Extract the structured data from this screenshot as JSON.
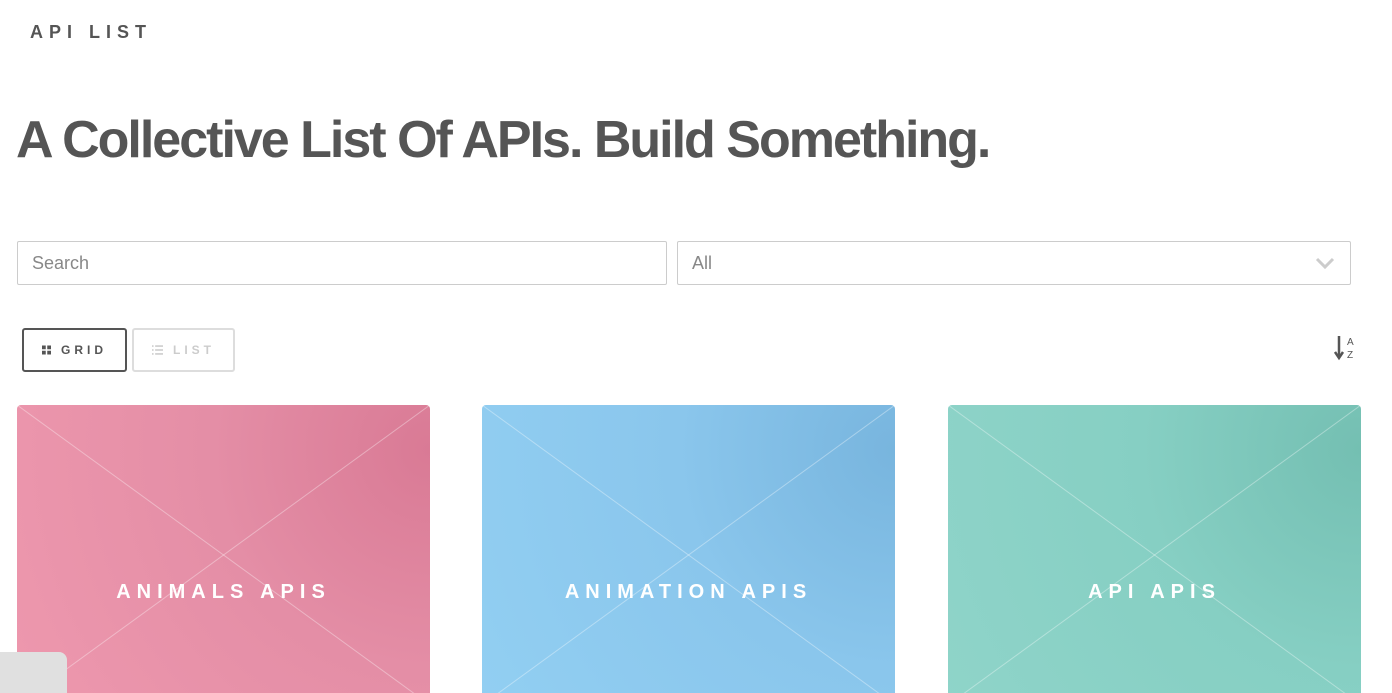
{
  "header": {
    "brand": "API LIST"
  },
  "hero": {
    "title": "A Collective List Of APIs. Build Something."
  },
  "search": {
    "placeholder": "Search",
    "value": ""
  },
  "category_select": {
    "selected": "All"
  },
  "view_toggle": {
    "grid_label": "GRID",
    "list_label": "LIST",
    "active": "grid"
  },
  "sort": {
    "icon": "sort-alpha-icon"
  },
  "cards": [
    {
      "label": "ANIMALS APIS",
      "color": "#e48ea6"
    },
    {
      "label": "ANIMATION APIS",
      "color": "#8ac6ec"
    },
    {
      "label": "API APIS",
      "color": "#86cfc3"
    }
  ]
}
